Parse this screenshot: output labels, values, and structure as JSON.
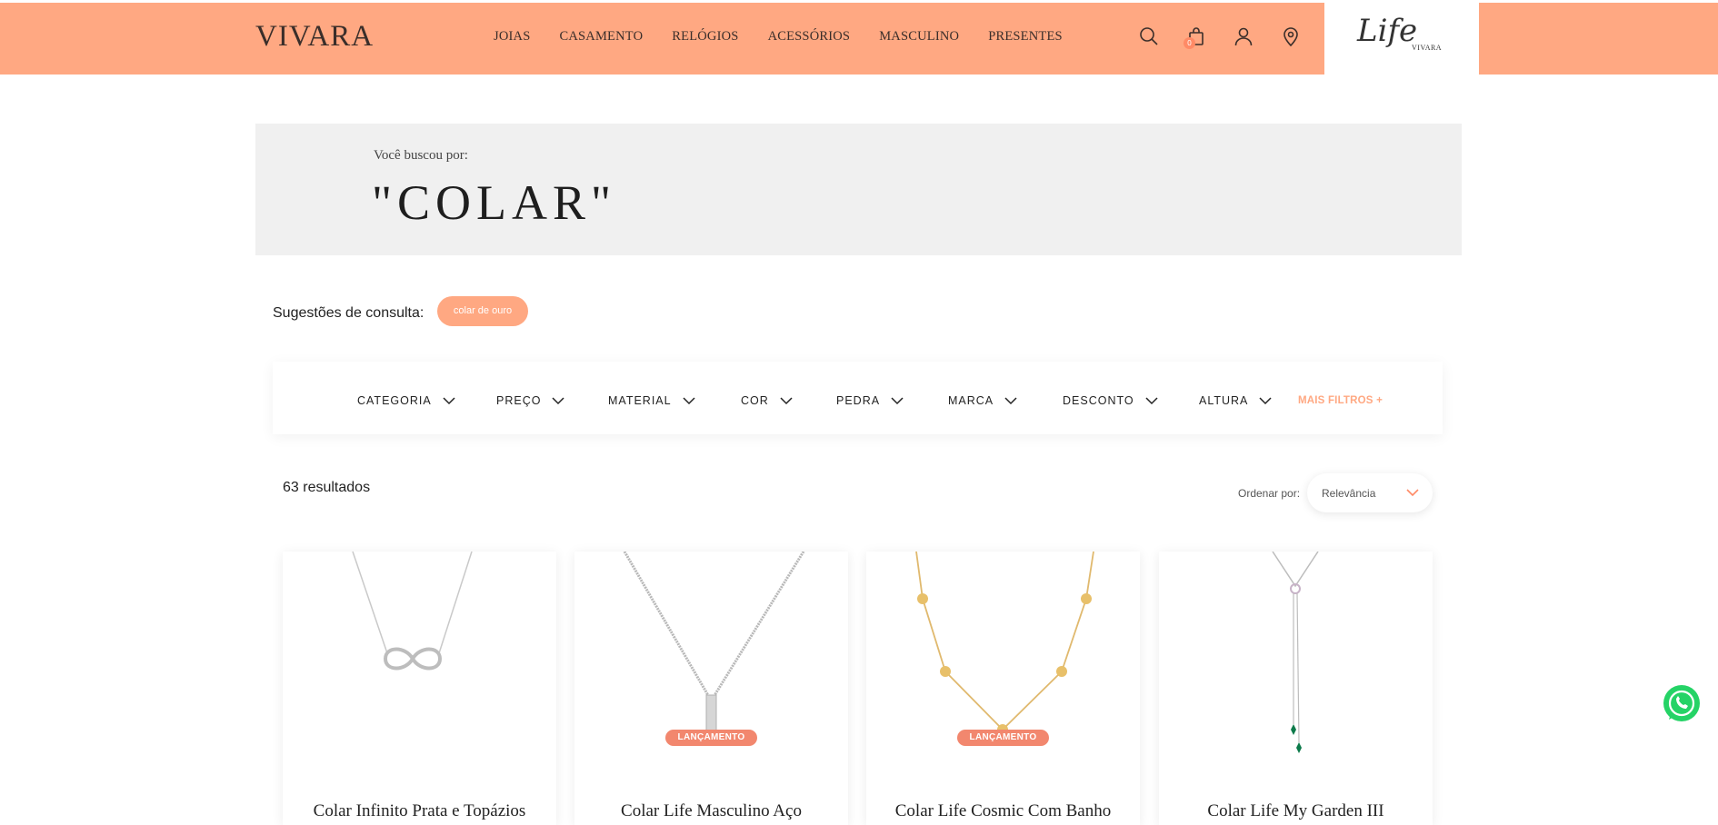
{
  "header": {
    "logo": "VIVARA",
    "nav": [
      "JOIAS",
      "CASAMENTO",
      "RELÓGIOS",
      "ACESSÓRIOS",
      "MASCULINO",
      "PRESENTES"
    ],
    "cart_count": "0",
    "life_logo": "Life",
    "life_sub": "VIVARA",
    "icons": [
      "search-icon",
      "cart-icon",
      "user-icon",
      "location-icon"
    ]
  },
  "search": {
    "label": "Você buscou por:",
    "term": "\"COLAR\""
  },
  "suggestions": {
    "label": "Sugestões de consulta:",
    "items": [
      "colar de ouro"
    ]
  },
  "filters": {
    "items": [
      "CATEGORIA",
      "PREÇO",
      "MATERIAL",
      "COR",
      "PEDRA",
      "MARCA",
      "DESCONTO",
      "ALTURA"
    ],
    "more": "MAIS FILTROS +"
  },
  "results": {
    "count": "63 resultados",
    "sort_label": "Ordenar por:",
    "sort_value": "Relevância"
  },
  "products": [
    {
      "title": "Colar Infinito Prata e Topázios",
      "badge": ""
    },
    {
      "title": "Colar Life Masculino Aço",
      "badge": "LANÇAMENTO"
    },
    {
      "title": "Colar Life Cosmic Com Banho",
      "badge": "LANÇAMENTO"
    },
    {
      "title": "Colar Life My Garden III",
      "badge": ""
    }
  ],
  "colors": {
    "brand": "#ffa882",
    "badge": "#f2876e",
    "whatsapp": "#25d366"
  }
}
